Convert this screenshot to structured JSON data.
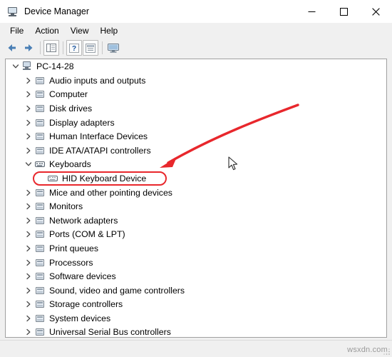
{
  "window": {
    "title": "Device Manager",
    "title_icon": "monitor-icon",
    "controls": {
      "minimize": "minimize-icon",
      "maximize": "maximize-icon",
      "close": "close-icon"
    }
  },
  "menubar": {
    "items": [
      {
        "label": "File"
      },
      {
        "label": "Action"
      },
      {
        "label": "View"
      },
      {
        "label": "Help"
      }
    ]
  },
  "toolbar": {
    "buttons": [
      {
        "name": "back-button",
        "icon": "arrow-left-icon"
      },
      {
        "name": "forward-button",
        "icon": "arrow-right-icon"
      },
      {
        "name": "show-hide-console-tree-button",
        "icon": "tree-panel-icon"
      },
      {
        "name": "help-button",
        "icon": "question-mark-icon"
      },
      {
        "name": "properties-button",
        "icon": "properties-icon"
      },
      {
        "name": "scan-for-hardware-changes-button",
        "icon": "scan-monitor-icon"
      }
    ]
  },
  "tree": {
    "root": {
      "label": "PC-14-28",
      "icon": "computer-icon",
      "expanded": true
    },
    "items": [
      {
        "label": "Audio inputs and outputs",
        "icon": "device-icon",
        "expanded": false,
        "depth": 1
      },
      {
        "label": "Computer",
        "icon": "device-icon",
        "expanded": false,
        "depth": 1
      },
      {
        "label": "Disk drives",
        "icon": "device-icon",
        "expanded": false,
        "depth": 1
      },
      {
        "label": "Display adapters",
        "icon": "device-icon",
        "expanded": false,
        "depth": 1
      },
      {
        "label": "Human Interface Devices",
        "icon": "device-icon",
        "expanded": false,
        "depth": 1
      },
      {
        "label": "IDE ATA/ATAPI controllers",
        "icon": "device-icon",
        "expanded": false,
        "depth": 1
      },
      {
        "label": "Keyboards",
        "icon": "keyboard-category-icon",
        "expanded": true,
        "depth": 1
      },
      {
        "label": "HID Keyboard Device",
        "icon": "keyboard-icon",
        "expanded": null,
        "depth": 2,
        "highlighted": true
      },
      {
        "label": "Mice and other pointing devices",
        "icon": "device-icon",
        "expanded": false,
        "depth": 1
      },
      {
        "label": "Monitors",
        "icon": "device-icon",
        "expanded": false,
        "depth": 1
      },
      {
        "label": "Network adapters",
        "icon": "device-icon",
        "expanded": false,
        "depth": 1
      },
      {
        "label": "Ports (COM & LPT)",
        "icon": "device-icon",
        "expanded": false,
        "depth": 1
      },
      {
        "label": "Print queues",
        "icon": "device-icon",
        "expanded": false,
        "depth": 1
      },
      {
        "label": "Processors",
        "icon": "device-icon",
        "expanded": false,
        "depth": 1
      },
      {
        "label": "Software devices",
        "icon": "device-icon",
        "expanded": false,
        "depth": 1
      },
      {
        "label": "Sound, video and game controllers",
        "icon": "device-icon",
        "expanded": false,
        "depth": 1
      },
      {
        "label": "Storage controllers",
        "icon": "device-icon",
        "expanded": false,
        "depth": 1
      },
      {
        "label": "System devices",
        "icon": "device-icon",
        "expanded": false,
        "depth": 1
      },
      {
        "label": "Universal Serial Bus controllers",
        "icon": "device-icon",
        "expanded": false,
        "depth": 1
      }
    ]
  },
  "annotations": {
    "highlight_color": "#e8272c",
    "arrow_color": "#e8272c",
    "arrow_target": "HID Keyboard Device"
  },
  "statusbar": {
    "watermark": "wsxdn.com"
  }
}
